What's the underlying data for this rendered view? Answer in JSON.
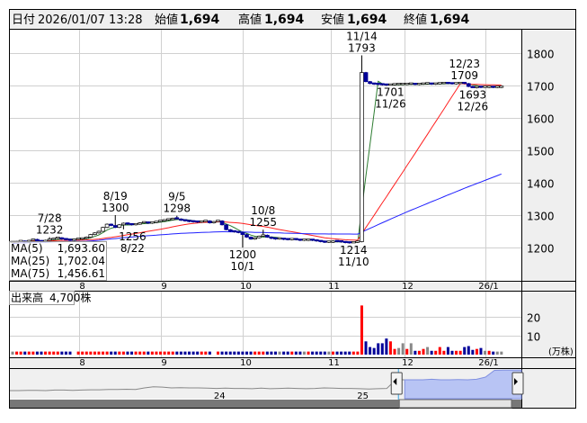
{
  "header": {
    "date_label": "日付",
    "datetime": "2026/01/07 13:28",
    "open_label": "始値",
    "open": "1,694",
    "high_label": "高値",
    "high": "1,694",
    "low_label": "安値",
    "low": "1,694",
    "close_label": "終値",
    "close": "1,694"
  },
  "colors": {
    "up_price": "#ff0000",
    "down_price": "#006400",
    "ma5": "#2e7d32",
    "ma25": "#ff2020",
    "ma75": "#2020ff",
    "candle_down": "#000099",
    "vol_up": "#ff0000",
    "vol_down": "#000099",
    "vol_flat": "#888888",
    "nav_fill": "#b8c4f4"
  },
  "legend": {
    "ma5_label": "MA(5)",
    "ma5_value": "1,693.60",
    "ma25_label": "MA(25)",
    "ma25_value": "1,702.04",
    "ma75_label": "MA(75)",
    "ma75_value": "1,456.61"
  },
  "volume_panel": {
    "label": "出来高",
    "value": "4,700株",
    "unit": "(万株)"
  },
  "navigator": {
    "labels": [
      "24",
      "25"
    ],
    "series": [
      20,
      20,
      21,
      21,
      20,
      22,
      22,
      21,
      22,
      23,
      23,
      24,
      24,
      25,
      24,
      30,
      34,
      33,
      30,
      31,
      30,
      30,
      29,
      28,
      29,
      28,
      28,
      27,
      29,
      27,
      28,
      29,
      28,
      27,
      28,
      30,
      29,
      28,
      28,
      27,
      26,
      27,
      28,
      60,
      60,
      60,
      60,
      62,
      60,
      60,
      61,
      60,
      62,
      70,
      95,
      96,
      96,
      96
    ],
    "selection_start": 0.77,
    "scroll_left_icon": "triangle-left-icon",
    "scroll_right_icon": "triangle-right-icon"
  },
  "chart_data": [
    {
      "type": "candlestick",
      "title": "",
      "ylim": [
        1100,
        1880
      ],
      "y_ticks": [
        "1200",
        "1300",
        "1400",
        "1500",
        "1600",
        "1700",
        "1800"
      ],
      "y_tick_values": [
        1200,
        1300,
        1400,
        1500,
        1600,
        1700,
        1800
      ],
      "x_ticks": [
        "8",
        "9",
        "10",
        "11",
        "12",
        "26/1"
      ],
      "x_tick_index": [
        16.3,
        36,
        56,
        77.5,
        95.5,
        115
      ],
      "closes": [
        1215,
        1218,
        1220,
        1216,
        1222,
        1225,
        1220,
        1218,
        1222,
        1225,
        1228,
        1230,
        1226,
        1224,
        1222,
        1225,
        1226,
        1228,
        1232,
        1240,
        1245,
        1250,
        1262,
        1272,
        1268,
        1262,
        1270,
        1275,
        1272,
        1270,
        1272,
        1276,
        1278,
        1275,
        1277,
        1280,
        1282,
        1285,
        1286,
        1290,
        1288,
        1284,
        1282,
        1280,
        1279,
        1278,
        1280,
        1282,
        1276,
        1280,
        1282,
        1270,
        1255,
        1250,
        1248,
        1246,
        1240,
        1232,
        1226,
        1230,
        1235,
        1238,
        1232,
        1228,
        1226,
        1226,
        1225,
        1224,
        1225,
        1224,
        1222,
        1222,
        1223,
        1222,
        1220,
        1218,
        1216,
        1216,
        1220,
        1218,
        1217,
        1215,
        1214,
        1216,
        1218,
        1740,
        1712,
        1706,
        1704,
        1703,
        1702,
        1701,
        1702,
        1703,
        1703,
        1703,
        1704,
        1704,
        1703,
        1704,
        1705,
        1705,
        1704,
        1705,
        1706,
        1707,
        1706,
        1705,
        1706,
        1708,
        1706,
        1697,
        1693,
        1695,
        1694,
        1694,
        1695,
        1694,
        1694,
        1694
      ],
      "annotations": [
        {
          "date": "7/28",
          "value": "1232",
          "index": 9,
          "price": 1232,
          "pos": "above"
        },
        {
          "date": "8/19",
          "value": "1300",
          "index": 25,
          "price": 1300,
          "pos": "above"
        },
        {
          "date": "8/22",
          "value": "1256",
          "index": 27,
          "price": 1256,
          "pos": "below"
        },
        {
          "date": "9/5",
          "value": "1298",
          "index": 40,
          "price": 1298,
          "pos": "above"
        },
        {
          "date": "10/1",
          "value": "1200",
          "index": 56,
          "price": 1200,
          "pos": "below"
        },
        {
          "date": "10/8",
          "value": "1255",
          "index": 61,
          "price": 1255,
          "pos": "above"
        },
        {
          "date": "11/10",
          "value": "1214",
          "index": 83,
          "price": 1214,
          "pos": "below"
        },
        {
          "date": "11/14",
          "value": "1793",
          "index": 85,
          "price": 1793,
          "pos": "above"
        },
        {
          "date": "11/26",
          "value": "1701",
          "index": 92,
          "price": 1701,
          "pos": "below"
        },
        {
          "date": "12/23",
          "value": "1709",
          "index": 110,
          "price": 1709,
          "pos": "above"
        },
        {
          "date": "12/26",
          "value": "1693",
          "index": 112,
          "price": 1693,
          "pos": "below"
        }
      ],
      "series": [
        {
          "name": "MA(5)",
          "period": 5
        },
        {
          "name": "MA(25)",
          "period": 25
        },
        {
          "name": "MA(75)",
          "period": 75
        }
      ]
    },
    {
      "type": "bar",
      "title": "出来高",
      "ylabel": "(万株)",
      "y_ticks": [
        "10",
        "20"
      ],
      "y_tick_values": [
        10,
        20
      ],
      "volumes": [
        1,
        1,
        1,
        1,
        1,
        1,
        1,
        1,
        1,
        1,
        1,
        1,
        1,
        1,
        1,
        0,
        1,
        1,
        1,
        1,
        1,
        1,
        1,
        1,
        1,
        1,
        1,
        1,
        1,
        1,
        1,
        1,
        1,
        1,
        1,
        1,
        1,
        1,
        1,
        1,
        1,
        1,
        1,
        1,
        1,
        1,
        1,
        1,
        1,
        0,
        1,
        1,
        1,
        1,
        1,
        1,
        1,
        1,
        1,
        1,
        1,
        1,
        1,
        1,
        1,
        1,
        1,
        1,
        1,
        1,
        1,
        1,
        1,
        1,
        1,
        1,
        1,
        1,
        1,
        1,
        1,
        1,
        1,
        1,
        1,
        26,
        7,
        4,
        3.5,
        6,
        6,
        8.5,
        7,
        3,
        3.5,
        6,
        3,
        6,
        2,
        2,
        3,
        4,
        2,
        2,
        4,
        2,
        4,
        2,
        2,
        2,
        4,
        4.5,
        2.5,
        3,
        3.5,
        2,
        2,
        1.5,
        1.5,
        1.5
      ]
    }
  ]
}
